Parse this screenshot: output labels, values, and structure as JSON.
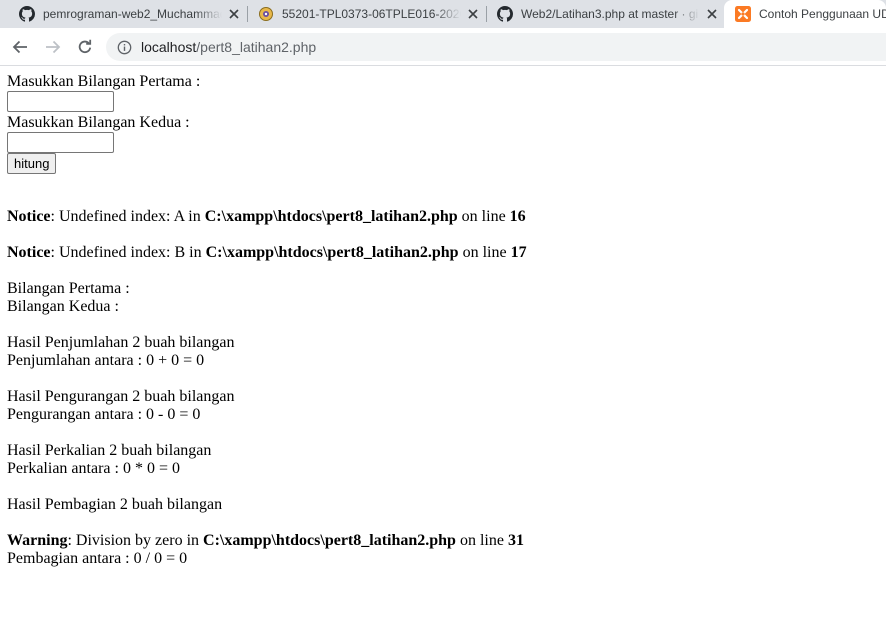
{
  "tabs": [
    {
      "title": "pemrograman-web2_Muchammad",
      "icon": "github-icon"
    },
    {
      "title": "55201-TPL0373-06TPLE016-2020",
      "icon": "course-icon"
    },
    {
      "title": "Web2/Latihan3.php at master · gi",
      "icon": "github-icon"
    },
    {
      "title": "Contoh Penggunaan UD",
      "icon": "xampp-icon",
      "active": true
    }
  ],
  "address_bar": {
    "host": "localhost",
    "path": "/pert8_latihan2.php"
  },
  "form": {
    "label_first": "Masukkan Bilangan Pertama :",
    "label_second": "Masukkan Bilangan Kedua :",
    "value_first": "",
    "value_second": "",
    "submit_label": "hitung"
  },
  "notices": [
    {
      "level": "Notice",
      "message": ": Undefined index: A in ",
      "file": "C:\\xampp\\htdocs\\pert8_latihan2.php",
      "on_line": " on line ",
      "line": "16"
    },
    {
      "level": "Notice",
      "message": ": Undefined index: B in ",
      "file": "C:\\xampp\\htdocs\\pert8_latihan2.php",
      "on_line": " on line ",
      "line": "17"
    }
  ],
  "output": {
    "first_label": "Bilangan Pertama :",
    "second_label": "Bilangan Kedua :",
    "sum_title": "Hasil Penjumlahan 2 buah bilangan",
    "sum_result": "Penjumlahan antara : 0 + 0 = 0",
    "diff_title": "Hasil Pengurangan 2 buah bilangan",
    "diff_result": "Pengurangan antara : 0 - 0 = 0",
    "mul_title": "Hasil Perkalian 2 buah bilangan",
    "mul_result": "Perkalian antara : 0 * 0 = 0",
    "div_title": "Hasil Pembagian 2 buah bilangan",
    "div_result": "Pembagian antara : 0 / 0 = 0"
  },
  "warning": {
    "level": "Warning",
    "message": ": Division by zero in ",
    "file": "C:\\xampp\\htdocs\\pert8_latihan2.php",
    "on_line": " on line ",
    "line": "31"
  },
  "colors": {
    "tabstrip": "#dee1e6",
    "omnibox": "#f1f3f4",
    "xampp": "#fb7a24",
    "course_icon": "#e8b84a"
  }
}
